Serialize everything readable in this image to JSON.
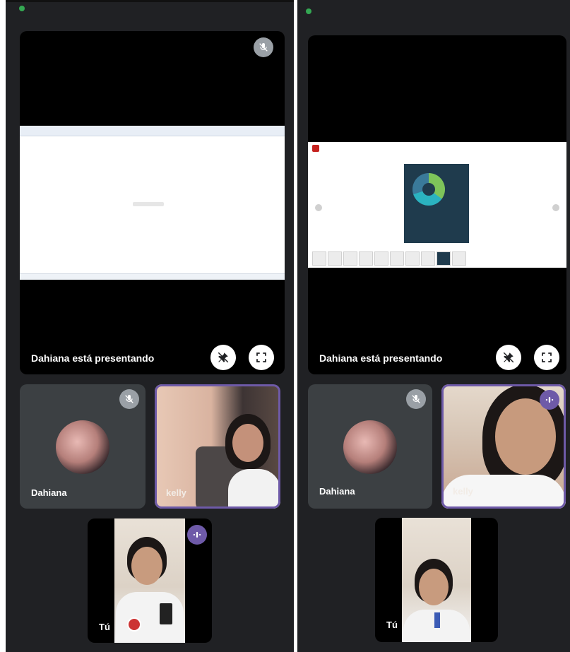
{
  "left": {
    "presentation_label": "Dahiana está presentando",
    "participants": [
      {
        "name": "Dahiana",
        "muted": true
      },
      {
        "name": "kelly",
        "speaking": false
      },
      {
        "name": "Tú",
        "speaking": true
      }
    ]
  },
  "right": {
    "presentation_label": "Dahiana está presentando",
    "participants": [
      {
        "name": "Dahiana",
        "muted": true
      },
      {
        "name": "kelly",
        "speaking": true
      },
      {
        "name": "Tú",
        "speaking": false
      }
    ]
  },
  "icons": {
    "mute": "mic-off-icon",
    "pin": "pin-off-icon",
    "fullscreen": "fullscreen-icon",
    "speaking": "audio-level-icon",
    "status": "green-status-dot"
  },
  "colors": {
    "panel_bg": "#202124",
    "tile_bg": "#3c4043",
    "active_border": "#6e5aa8",
    "status_green": "#34a853"
  }
}
